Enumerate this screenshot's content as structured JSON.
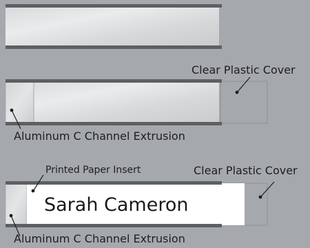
{
  "labels": {
    "clear_plastic_cover_1": "Clear Plastic Cover",
    "aluminum_extrusion_1": "Aluminum C Channel Extrusion",
    "printed_paper_insert": "Printed Paper Insert",
    "clear_plastic_cover_2": "Clear Plastic Cover",
    "aluminum_extrusion_2": "Aluminum C Channel Extrusion"
  },
  "insert": {
    "name": "Sarah Cameron"
  },
  "colors": {
    "background": "#a5a9ad",
    "aluminum_light": "#e2e3e4",
    "aluminum_mid": "#cdcfd1",
    "rail_dark": "#5f6264",
    "insert_paper": "#ffffff"
  }
}
